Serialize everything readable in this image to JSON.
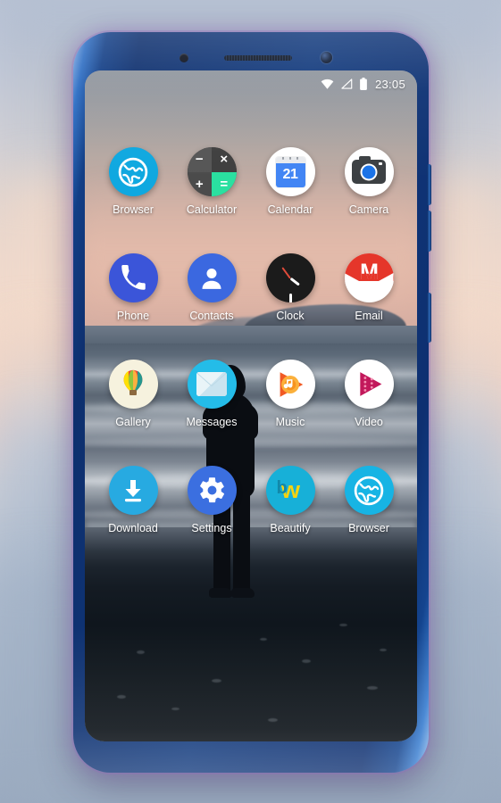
{
  "device": {
    "name": "smartphone-mockup",
    "frame_color": "#123a7d",
    "glow_color": "#986ac4",
    "hardware": {
      "sensor": "proximity-sensor",
      "earpiece": "earpiece-speaker",
      "front_camera": "front-camera",
      "buttons": [
        "volume-up",
        "volume-down",
        "power"
      ]
    }
  },
  "wallpaper": {
    "description": "Person in dark hooded jacket standing on a dark wet-sand beach at dusk, ocean surf and distant headland, pink-grey sky",
    "sky_color": "#dcb6a8",
    "sea_color": "#7d8894",
    "sand_color": "#0f161d"
  },
  "statusbar": {
    "wifi_icon": "wifi-icon",
    "signal_icon": "signal-triangle-icon",
    "battery_icon": "battery-icon",
    "time": "23:05",
    "text_color": "#ffffff"
  },
  "homescreen": {
    "rows": [
      {
        "apps": [
          {
            "label": "Browser",
            "icon": "browser-globe-icon",
            "bg": "#0fa8e0"
          },
          {
            "label": "Calculator",
            "icon": "calculator-icon",
            "bg": "#4a4a4a",
            "keys": [
              "−",
              "×",
              "+",
              "="
            ],
            "accent": "#2ae0a0"
          },
          {
            "label": "Calendar",
            "icon": "calendar-icon",
            "bg": "#ffffff",
            "day": "21",
            "accent": "#4285f4"
          },
          {
            "label": "Camera",
            "icon": "camera-icon",
            "bg": "#ffffff",
            "accent": "#1a73e8"
          }
        ]
      },
      {
        "apps": [
          {
            "label": "Phone",
            "icon": "phone-handset-icon",
            "bg": "#3b55d9"
          },
          {
            "label": "Contacts",
            "icon": "contacts-person-icon",
            "bg": "#3b68e0"
          },
          {
            "label": "Clock",
            "icon": "clock-icon",
            "bg": "#1b1b1b",
            "accent": "#e04b3a"
          },
          {
            "label": "Email",
            "icon": "email-envelope-icon",
            "bg": "#ffffff",
            "accent": "#e5362a",
            "letter": "M"
          }
        ]
      },
      {
        "apps": [
          {
            "label": "Gallery",
            "icon": "gallery-balloon-icon",
            "bg": "#f6f2de"
          },
          {
            "label": "Messages",
            "icon": "messages-bubble-icon",
            "bg": "#24bce8"
          },
          {
            "label": "Music",
            "icon": "music-play-note-icon",
            "bg": "#ffffff",
            "accent": "#f47b20"
          },
          {
            "label": "Video",
            "icon": "video-play-film-icon",
            "bg": "#ffffff",
            "accent": "#c2185b"
          }
        ]
      },
      {
        "apps": [
          {
            "label": "Download",
            "icon": "download-arrow-icon",
            "bg": "#27aae1"
          },
          {
            "label": "Settings",
            "icon": "settings-gear-icon",
            "bg": "#3b6fe0"
          },
          {
            "label": "Beautify",
            "icon": "beautify-w-icon",
            "bg": "#17b0d8",
            "letter": "w",
            "accent": "#f5d312"
          },
          {
            "label": "Browser",
            "icon": "browser-globe-icon",
            "bg": "#17b4e4"
          }
        ]
      }
    ]
  }
}
